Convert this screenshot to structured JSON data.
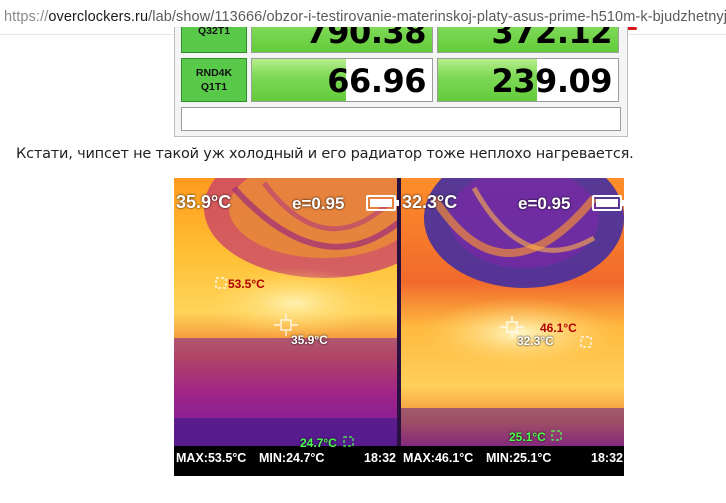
{
  "address_bar": {
    "scheme": "https://",
    "domain": "overclockers.ru",
    "path_before": "/lab/show/113666/obzor-i-testirovanie-materinskoj-platy-",
    "path_highlight": "asus-prime-h510m-k",
    "path_after": "-bjudzhetnyj-ko"
  },
  "benchmark": {
    "rows": [
      {
        "label_line1": "Q32T1",
        "label_line2": "",
        "read": "790.38",
        "write": "372.12"
      },
      {
        "label_line1": "RND4K",
        "label_line2": "Q1T1",
        "read": "66.96",
        "write": "239.09"
      }
    ],
    "fill_fraction": {
      "read_rnd4k": 0.52,
      "write_rnd4k": 0.55
    }
  },
  "article": {
    "sentence": "Кстати, чипсет не такой уж холодный и его радиатор тоже неплохо нагревается."
  },
  "thermal_left": {
    "center_temp": "35.9°C",
    "emissivity": "e=0.95",
    "hot_marker": "53.5°C",
    "cursor_temp": "35.9°C",
    "cold_marker": "24.7°C",
    "max": "MAX:53.5°C",
    "min": "MIN:24.7°C",
    "time": "18:32"
  },
  "thermal_right": {
    "center_temp": "32.3°C",
    "emissivity": "e=0.95",
    "hot_marker": "46.1°C",
    "cursor_temp": "32.3°C",
    "cold_marker": "25.1°C",
    "max": "MAX:46.1°C",
    "min": "MIN:25.1°C",
    "time": "18:32"
  },
  "colors": {
    "underline": "#d7191c",
    "bar_green": "#62cc3a",
    "label_green": "#59c94a"
  }
}
